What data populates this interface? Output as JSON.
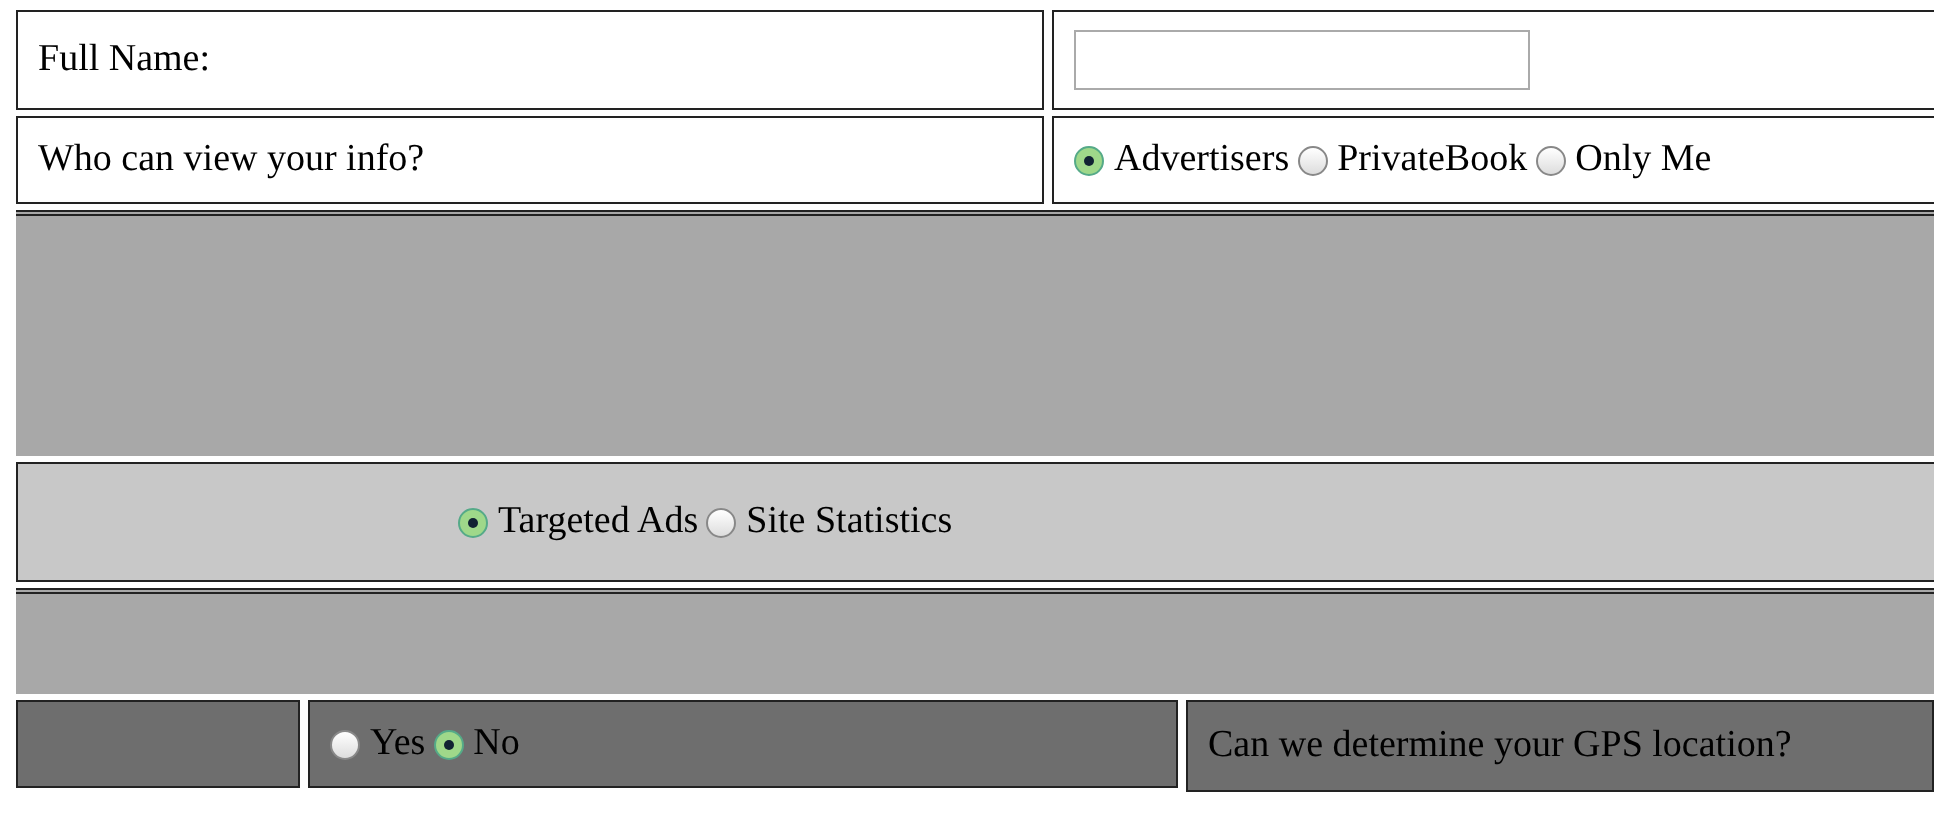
{
  "rows": [
    {
      "kind": "text",
      "color": "#ffffff",
      "label": "Full Name:"
    },
    {
      "kind": "choice",
      "color": "#ffffff",
      "label": "Who can view your info?",
      "options": [
        {
          "label": "Advertisers",
          "selected": true
        },
        {
          "label": "PrivateBook",
          "selected": false
        },
        {
          "label": "Only Me",
          "selected": false
        }
      ]
    },
    {
      "kind": "band",
      "color": "#a8a8a8"
    },
    {
      "kind": "choice",
      "color": "#c8c8c8",
      "options": [
        {
          "label": "Targeted Ads",
          "selected": true
        },
        {
          "label": "Site Statistics",
          "selected": false
        }
      ]
    },
    {
      "kind": "band",
      "color": "#a8a8a8"
    },
    {
      "kind": "question",
      "color": "#6e6e6e",
      "options": [
        {
          "label": "Yes",
          "selected": false
        },
        {
          "label": "No",
          "selected": true
        }
      ],
      "question": "Can we determine your GPS location?"
    }
  ]
}
